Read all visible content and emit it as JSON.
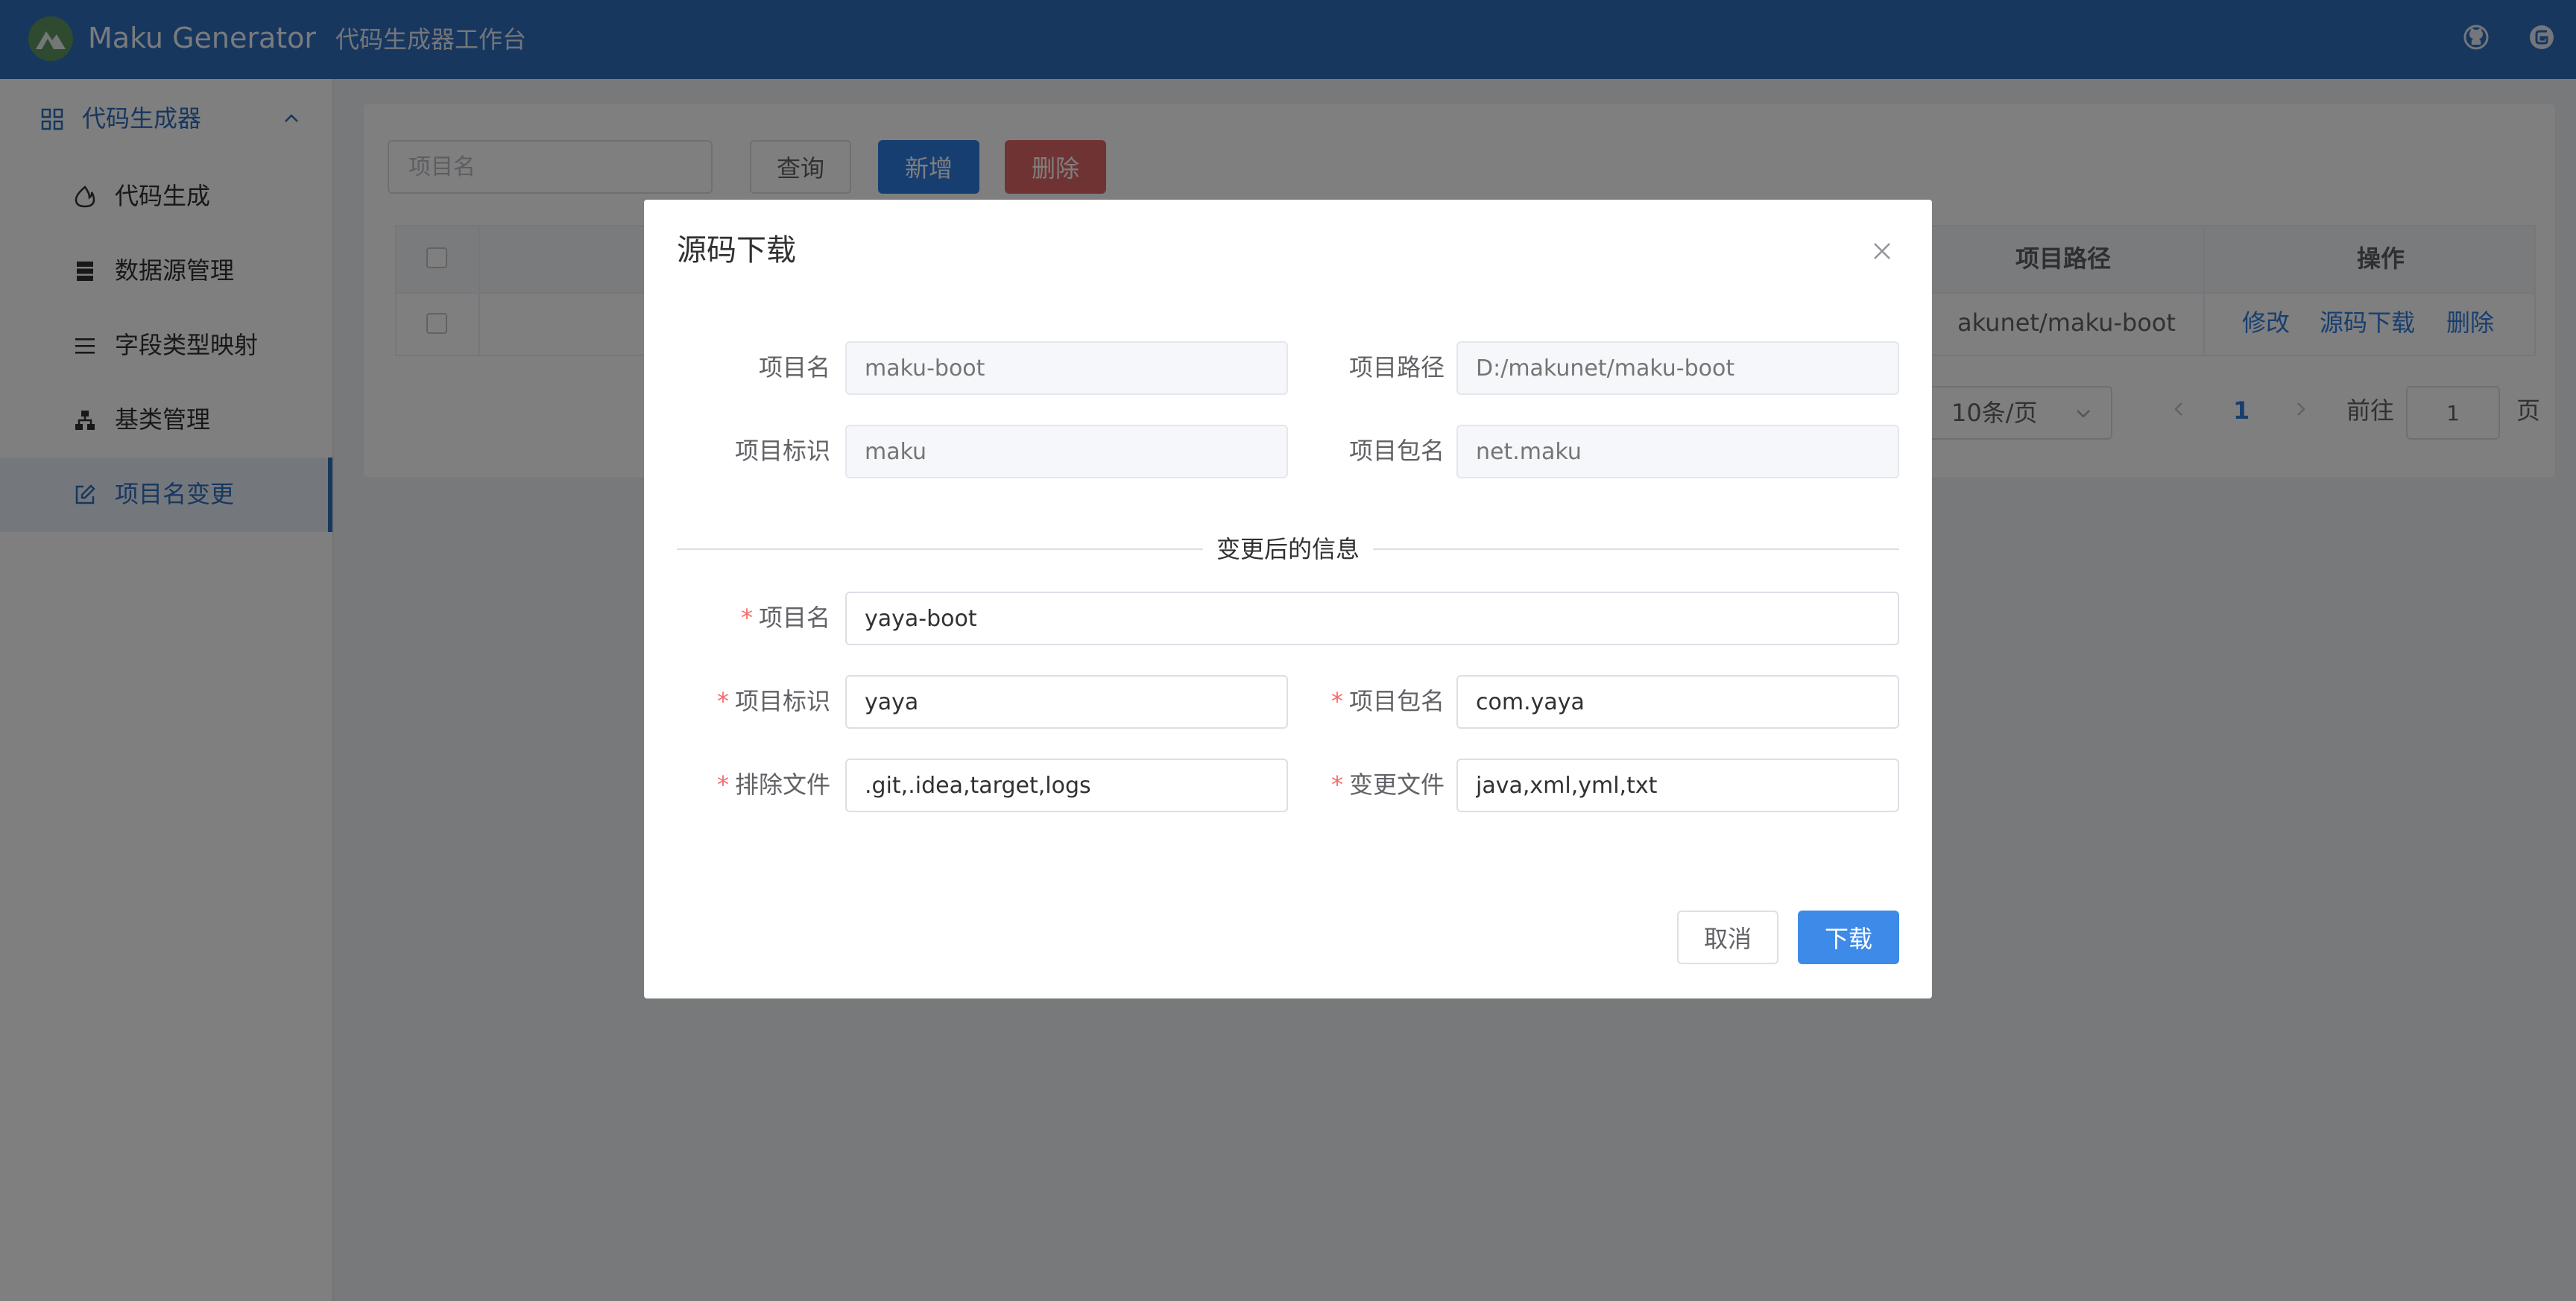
{
  "header": {
    "app_title": "Maku Generator",
    "app_subtitle": "代码生成器工作台",
    "icons": [
      "logo-icon",
      "github-icon",
      "gitee-icon"
    ],
    "bg_color": "#2f6fbf"
  },
  "sidebar": {
    "group_label": "代码生成器",
    "items": [
      {
        "label": "代码生成",
        "icon": "fire-icon"
      },
      {
        "label": "数据源管理",
        "icon": "database-icon"
      },
      {
        "label": "字段类型映射",
        "icon": "list-icon"
      },
      {
        "label": "基类管理",
        "icon": "hierarchy-icon"
      },
      {
        "label": "项目名变更",
        "icon": "edit-icon",
        "active": true
      }
    ],
    "accent_color": "#2f6fbf"
  },
  "main": {
    "search_placeholder": "项目名",
    "buttons": {
      "query": "查询",
      "add": "新增",
      "delete": "删除"
    },
    "table": {
      "headers": {
        "path": "项目路径",
        "actions": "操作"
      },
      "row": {
        "path": "akunet/maku-boot",
        "actions": {
          "edit": "修改",
          "download": "源码下载",
          "delete": "删除"
        }
      }
    },
    "pagination": {
      "page_size": "10条/页",
      "current_page": "1",
      "goto_label": "前往",
      "goto_value": "1",
      "page_unit": "页"
    }
  },
  "dialog": {
    "title": "源码下载",
    "original": {
      "project_name_label": "项目名",
      "project_name": "maku-boot",
      "project_path_label": "项目路径",
      "project_path": "D:/makunet/maku-boot",
      "project_code_label": "项目标识",
      "project_code": "maku",
      "project_package_label": "项目包名",
      "project_package": "net.maku"
    },
    "divider": "变更后的信息",
    "changed": {
      "required_mark": "*",
      "project_name_label": "项目名",
      "project_name": "yaya-boot",
      "project_code_label": "项目标识",
      "project_code": "yaya",
      "project_package_label": "项目包名",
      "project_package": "com.yaya",
      "exclude_label": "排除文件",
      "exclude": ".git,.idea,target,logs",
      "change_files_label": "变更文件",
      "change_files": "java,xml,yml,txt"
    },
    "buttons": {
      "cancel": "取消",
      "download": "下载"
    }
  }
}
